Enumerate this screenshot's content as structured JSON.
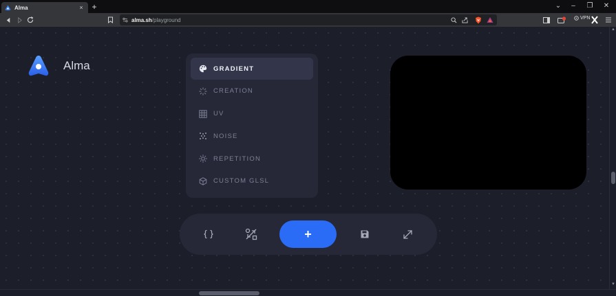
{
  "browser": {
    "tab": {
      "title": "Alma",
      "close": "×"
    },
    "new_tab": "+",
    "window_controls": {
      "chevron": "⌄",
      "minimize": "–",
      "maximize": "❐",
      "close": "✕"
    },
    "address": {
      "host": "alma.sh",
      "path": "/playground"
    },
    "vpn_label": "VPN",
    "brave_color": "#fb542b"
  },
  "app": {
    "brand": "Alma",
    "accent": "#2a6cf6",
    "menu": [
      {
        "label": "GRADIENT",
        "icon": "palette-icon",
        "active": true
      },
      {
        "label": "CREATION",
        "icon": "sparkle-icon",
        "active": false
      },
      {
        "label": "UV",
        "icon": "grid-icon",
        "active": false
      },
      {
        "label": "NOISE",
        "icon": "noise-icon",
        "active": false
      },
      {
        "label": "REPETITION",
        "icon": "sun-icon",
        "active": false
      },
      {
        "label": "CUSTOM GLSL",
        "icon": "cube-icon",
        "active": false
      }
    ],
    "toolbar": {
      "code_icon": "code-braces-icon",
      "nodes_icon": "nodes-icon",
      "add_label": "+",
      "save_icon": "save-icon",
      "expand_icon": "expand-icon"
    }
  }
}
